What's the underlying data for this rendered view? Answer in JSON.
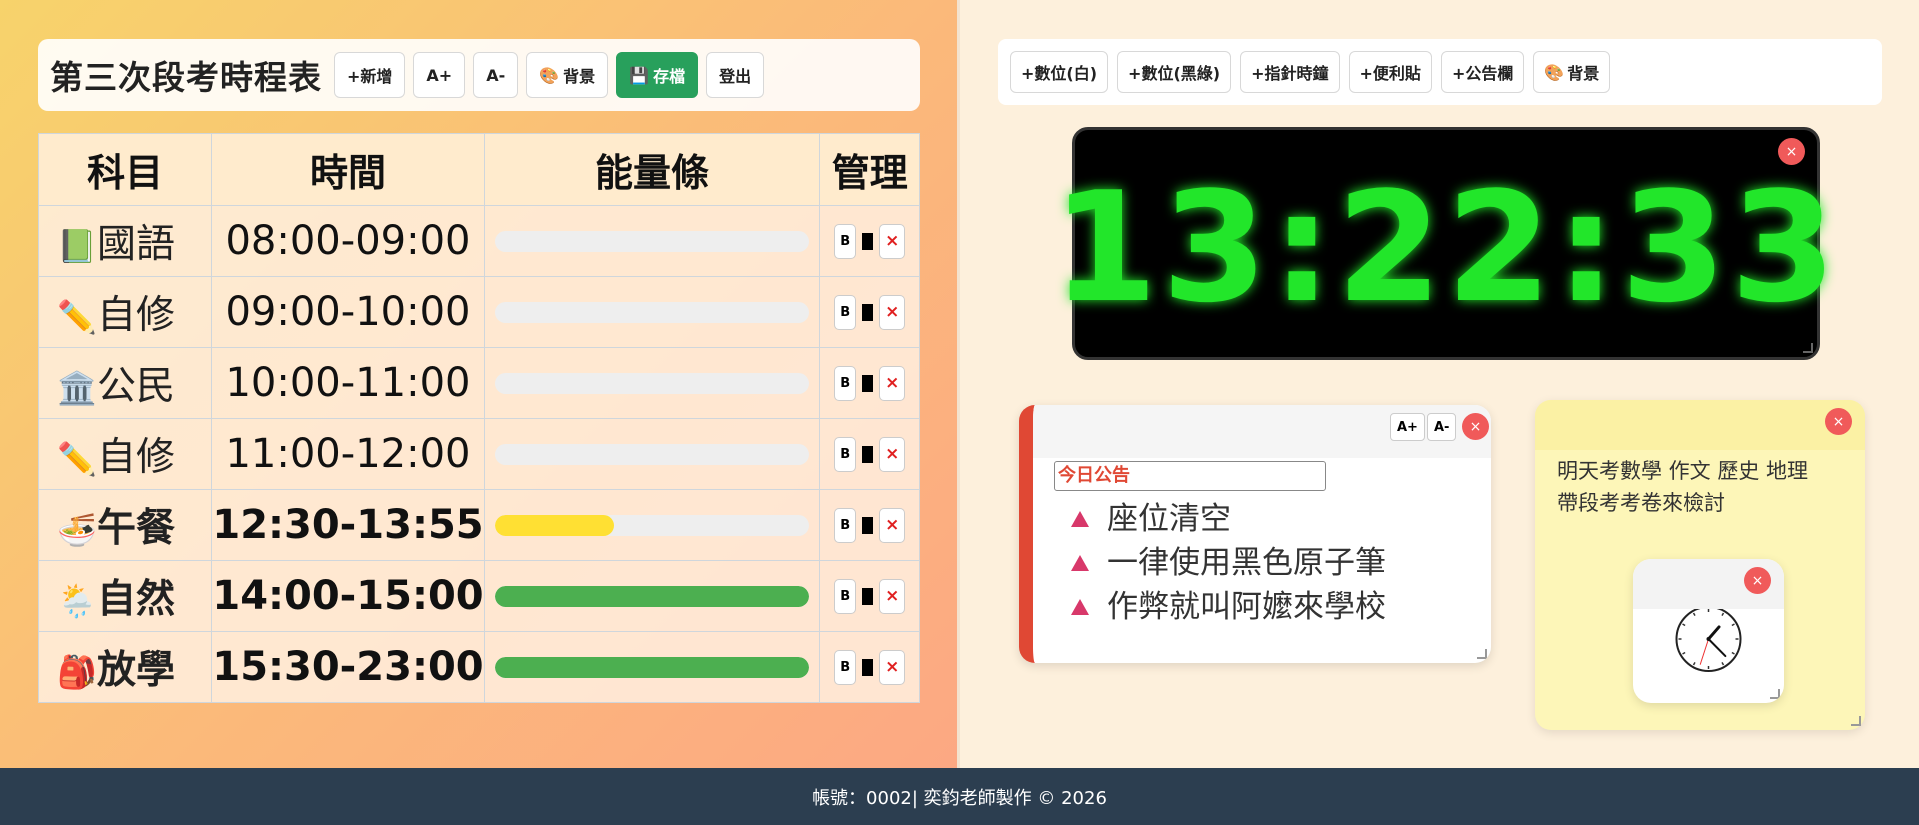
{
  "header": {
    "title": "第三次段考時程表",
    "buttons": {
      "add": "+新增",
      "font_up": "A+",
      "font_down": "A-",
      "background": "背景",
      "save": "存檔",
      "logout": "登出"
    }
  },
  "schedule": {
    "columns": [
      "科目",
      "時間",
      "能量條",
      "管理"
    ],
    "rows": [
      {
        "icon": "📗",
        "icon_name": "green-book-icon",
        "subject": "國語",
        "time": "08:00-09:00",
        "progress": 0,
        "bar_color": "#eeeeee"
      },
      {
        "icon": "✏️",
        "icon_name": "pencil-icon",
        "subject": "自修",
        "time": "09:00-10:00",
        "progress": 0,
        "bar_color": "#eeeeee"
      },
      {
        "icon": "🏛️",
        "icon_name": "classical-building-icon",
        "subject": "公民",
        "time": "10:00-11:00",
        "progress": 0,
        "bar_color": "#eeeeee"
      },
      {
        "icon": "✏️",
        "icon_name": "pencil-icon",
        "subject": "自修",
        "time": "11:00-12:00",
        "progress": 0,
        "bar_color": "#eeeeee"
      },
      {
        "icon": "🍜",
        "icon_name": "noodle-bowl-icon",
        "subject": "午餐",
        "time": "12:30-13:55",
        "progress": 0.38,
        "bar_color": "#ffe033"
      },
      {
        "icon": "🌦️",
        "icon_name": "sun-rain-cloud-icon",
        "subject": "自然",
        "time": "14:00-15:00",
        "progress": 1.0,
        "bar_color": "#4caf50"
      },
      {
        "icon": "🎒",
        "icon_name": "backpack-icon",
        "subject": "放學",
        "time": "15:30-23:00",
        "progress": 1.0,
        "bar_color": "#4caf50"
      }
    ],
    "mgmt": {
      "bold": "B",
      "delete": "×"
    }
  },
  "widget_toolbar": {
    "buttons": [
      "+數位(白)",
      "+數位(黑綠)",
      "+指針時鐘",
      "+便利貼",
      "+公告欄"
    ],
    "background": "背景"
  },
  "digital_clock": {
    "time": "13:22:33",
    "color": "#22e62a"
  },
  "notice_board": {
    "font_up": "A+",
    "font_down": "A-",
    "title": "今日公告",
    "items": [
      "座位清空",
      "一律使用黑色原子筆",
      "作弊就叫阿嬤來學校"
    ]
  },
  "sticky_note": {
    "lines": [
      "明天考數學 作文 歷史 地理",
      "帶段考考卷來檢討"
    ]
  },
  "analog_clock": {
    "hour": 13,
    "minute": 22,
    "second": 33
  },
  "close_label": "×",
  "footer": {
    "text": "帳號：0002| 奕鈞老師製作 © 2026"
  }
}
